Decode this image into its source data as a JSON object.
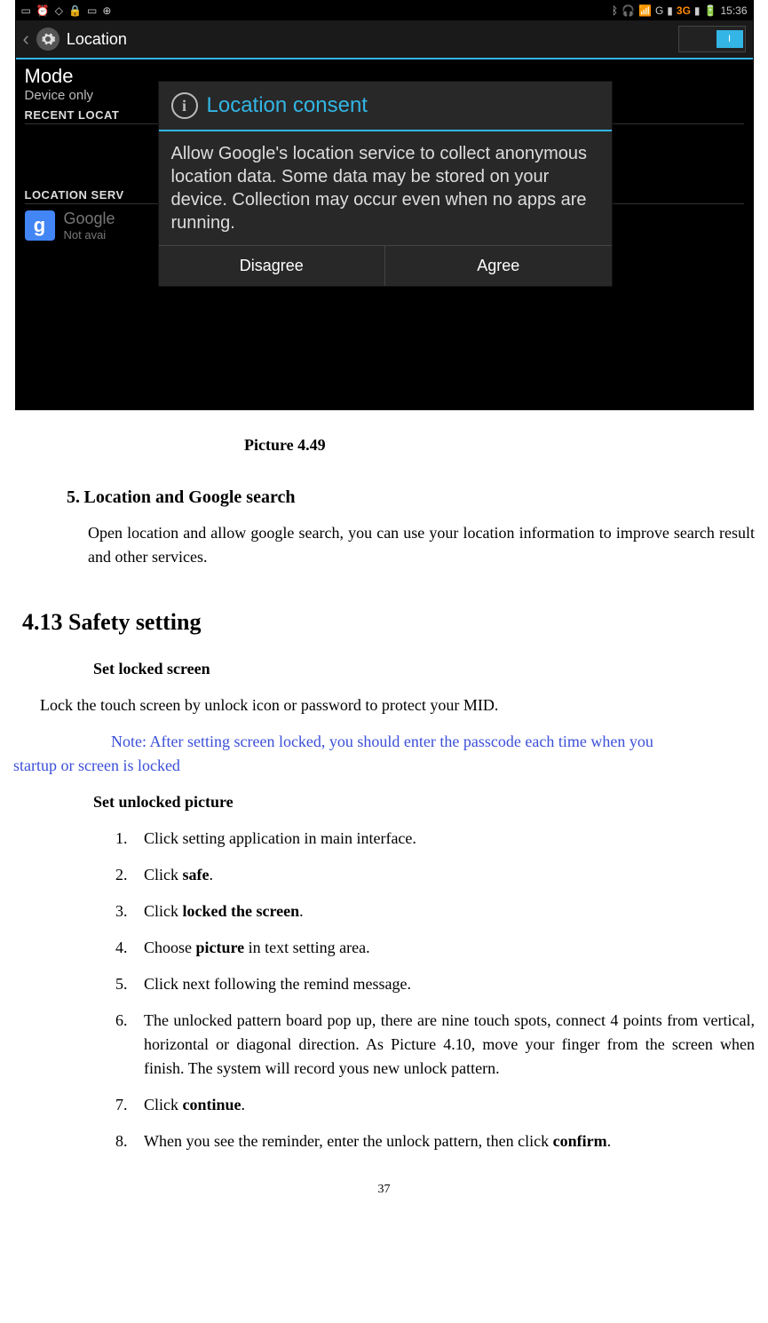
{
  "screenshot": {
    "statusbar": {
      "time": "15:36",
      "network": "3G",
      "g_label": "G"
    },
    "header": {
      "back": "‹",
      "title": "Location",
      "toggle": "I"
    },
    "settings": {
      "mode_label": "Mode",
      "mode_value": "Device only",
      "recent_section": "RECENT LOCAT",
      "services_section": "LOCATION SERV",
      "google_title": "Google",
      "google_sub": "Not avai",
      "g_letter": "g"
    },
    "dialog": {
      "info": "i",
      "title": "Location consent",
      "body": "Allow Google's location service to collect anonymous location data. Some data may be stored on your device. Collection may occur even when no apps are running.",
      "disagree": "Disagree",
      "agree": "Agree"
    }
  },
  "doc": {
    "caption": "Picture 4.49",
    "section5_num": "5.",
    "section5_title": "Location and Google search",
    "section5_body": "Open location and allow google search, you can use your location information to improve search result and other services.",
    "h413": "4.13  Safety setting",
    "set_locked": "Set locked screen",
    "lock_body": "Lock the touch screen by unlock icon or password to protect your MID.",
    "note_line1": "Note: After setting screen locked, you should enter the passcode each time when you",
    "note_line2": "startup or screen is locked",
    "set_unlocked": "Set unlocked picture",
    "steps": {
      "n1": "1.",
      "t1": "Click setting application in main interface.",
      "n2": "2.",
      "t2a": "Click ",
      "t2b": "safe",
      "t2c": ".",
      "n3": "3.",
      "t3a": "Click ",
      "t3b": "locked the screen",
      "t3c": ".",
      "n4": "4.",
      "t4a": "Choose ",
      "t4b": "picture",
      "t4c": " in text setting area.",
      "n5": "5.",
      "t5": "Click next following the remind message.",
      "n6": "6.",
      "t6": "The unlocked pattern board pop up, there are nine touch spots, connect 4 points from vertical, horizontal or diagonal direction. As Picture 4.10, move your finger from the screen when finish. The system will record yous new unlock pattern.",
      "n7": "7.",
      "t7a": "Click ",
      "t7b": "continue",
      "t7c": ".",
      "n8": "8.",
      "t8a": "When you see the reminder, enter the unlock pattern, then click ",
      "t8b": "confirm",
      "t8c": "."
    },
    "page": "37"
  }
}
